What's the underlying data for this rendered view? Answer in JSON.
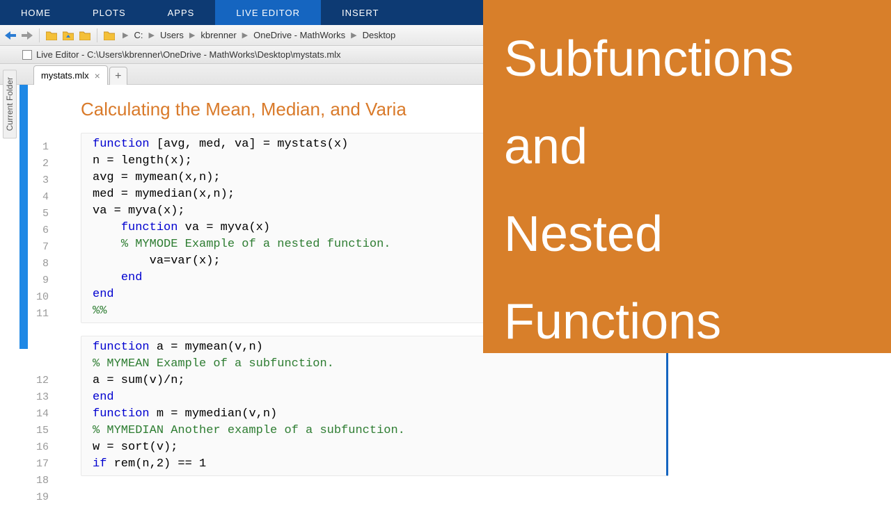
{
  "topbar": {
    "tabs": [
      "HOME",
      "PLOTS",
      "APPS",
      "LIVE EDITOR",
      "INSERT"
    ],
    "active": 3
  },
  "breadcrumb": [
    "C:",
    "Users",
    "kbrenner",
    "OneDrive - MathWorks",
    "Desktop"
  ],
  "titlebar": "Live Editor - C:\\Users\\kbrenner\\OneDrive - MathWorks\\Desktop\\mystats.mlx",
  "filetab": "mystats.mlx",
  "vertical_label": "Current Folder",
  "doc_title": "Calculating the Mean, Median, and Varia",
  "overlay": {
    "line1": "Subfunctions",
    "line2": "and",
    "line3": "Nested",
    "line4": "Functions"
  },
  "code1": [
    {
      "n": 1,
      "tokens": [
        {
          "t": "function ",
          "c": "kw"
        },
        {
          "t": "[avg, med, va] = mystats(x)"
        }
      ]
    },
    {
      "n": 2,
      "tokens": [
        {
          "t": "n = length(x);"
        }
      ]
    },
    {
      "n": 3,
      "tokens": [
        {
          "t": "avg = mymean(x,n);"
        }
      ]
    },
    {
      "n": 4,
      "tokens": [
        {
          "t": "med = mymedian(x,n);"
        }
      ]
    },
    {
      "n": 5,
      "tokens": [
        {
          "t": "va = myva(x);"
        }
      ]
    },
    {
      "n": 6,
      "tokens": [
        {
          "t": "    "
        },
        {
          "t": "function ",
          "c": "kw"
        },
        {
          "t": "va = myva(x)"
        }
      ]
    },
    {
      "n": 7,
      "tokens": [
        {
          "t": "    "
        },
        {
          "t": "% MYMODE Example of a nested function.",
          "c": "cm"
        }
      ]
    },
    {
      "n": 8,
      "tokens": [
        {
          "t": "        va=var(x);"
        }
      ]
    },
    {
      "n": 9,
      "tokens": [
        {
          "t": "    "
        },
        {
          "t": "end",
          "c": "kw"
        }
      ]
    },
    {
      "n": 10,
      "tokens": [
        {
          "t": "end",
          "c": "kw"
        }
      ]
    },
    {
      "n": 11,
      "tokens": [
        {
          "t": "%%",
          "c": "cm"
        }
      ]
    }
  ],
  "code2": [
    {
      "n": 12,
      "tokens": [
        {
          "t": "function ",
          "c": "kw"
        },
        {
          "t": "a = mymean(v,n)"
        }
      ]
    },
    {
      "n": 13,
      "tokens": [
        {
          "t": "% MYMEAN Example of a subfunction.",
          "c": "cm"
        }
      ]
    },
    {
      "n": 14,
      "tokens": [
        {
          "t": "a = sum(v)/n;"
        }
      ]
    },
    {
      "n": 15,
      "tokens": [
        {
          "t": "end",
          "c": "kw"
        }
      ]
    },
    {
      "n": 16,
      "tokens": [
        {
          "t": "function ",
          "c": "kw"
        },
        {
          "t": "m = mymedian(v,n)"
        }
      ]
    },
    {
      "n": 17,
      "tokens": [
        {
          "t": "% MYMEDIAN Another example of a subfunction.",
          "c": "cm"
        }
      ]
    },
    {
      "n": 18,
      "tokens": [
        {
          "t": "w = sort(v);"
        }
      ]
    },
    {
      "n": 19,
      "tokens": [
        {
          "t": "if ",
          "c": "kw"
        },
        {
          "t": "rem(n,2) == 1"
        }
      ]
    }
  ]
}
